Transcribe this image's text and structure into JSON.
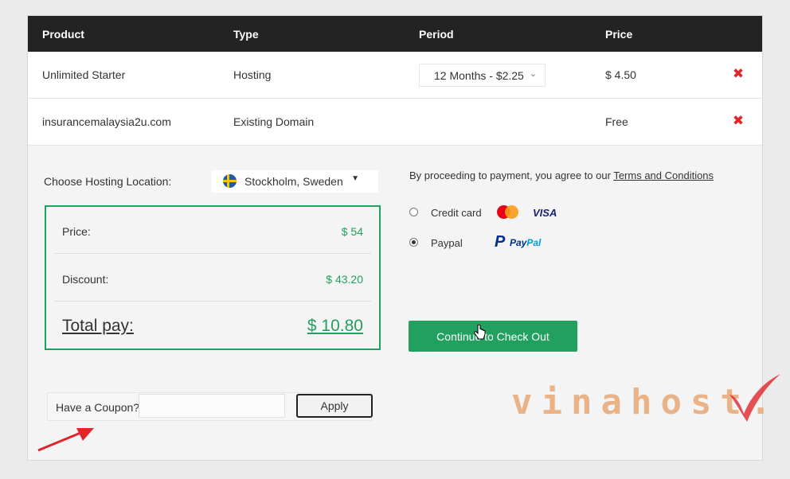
{
  "table": {
    "headers": [
      "Product",
      "Type",
      "Period",
      "Price"
    ],
    "rows": [
      {
        "product": "Unlimited Starter",
        "type": "Hosting",
        "period": "12 Months - $2.25",
        "price": "$ 4.50",
        "remove": "✖"
      },
      {
        "product": "insurancemalaysia2u.com",
        "type": "Existing Domain",
        "period": "",
        "price": "Free",
        "remove": "✖"
      }
    ]
  },
  "location": {
    "label": "Choose Hosting Location:",
    "selected": "Stockholm, Sweden"
  },
  "summary": {
    "price_label": "Price:",
    "price_value": "$ 54",
    "discount_label": "Discount:",
    "discount_value": "$ 43.20",
    "total_label": "Total pay:",
    "total_value": "$ 10.80"
  },
  "coupon": {
    "label": "Have a Coupon?",
    "value": "",
    "apply_label": "Apply"
  },
  "payment": {
    "terms_text": "By proceeding to payment, you agree to our ",
    "terms_link": "Terms and Conditions",
    "options": [
      {
        "label": "Credit card",
        "selected": false,
        "brand": "VISA"
      },
      {
        "label": "Paypal",
        "selected": true,
        "brand_a": "Pay",
        "brand_b": "Pal"
      }
    ],
    "checkout_label": "Continue to Check Out"
  },
  "watermark": "vinahost.",
  "colors": {
    "accent": "#21a060",
    "header_bg": "#232323",
    "remove": "#e0262b",
    "arrow": "#e0262b",
    "watermark": "#e8a874"
  }
}
